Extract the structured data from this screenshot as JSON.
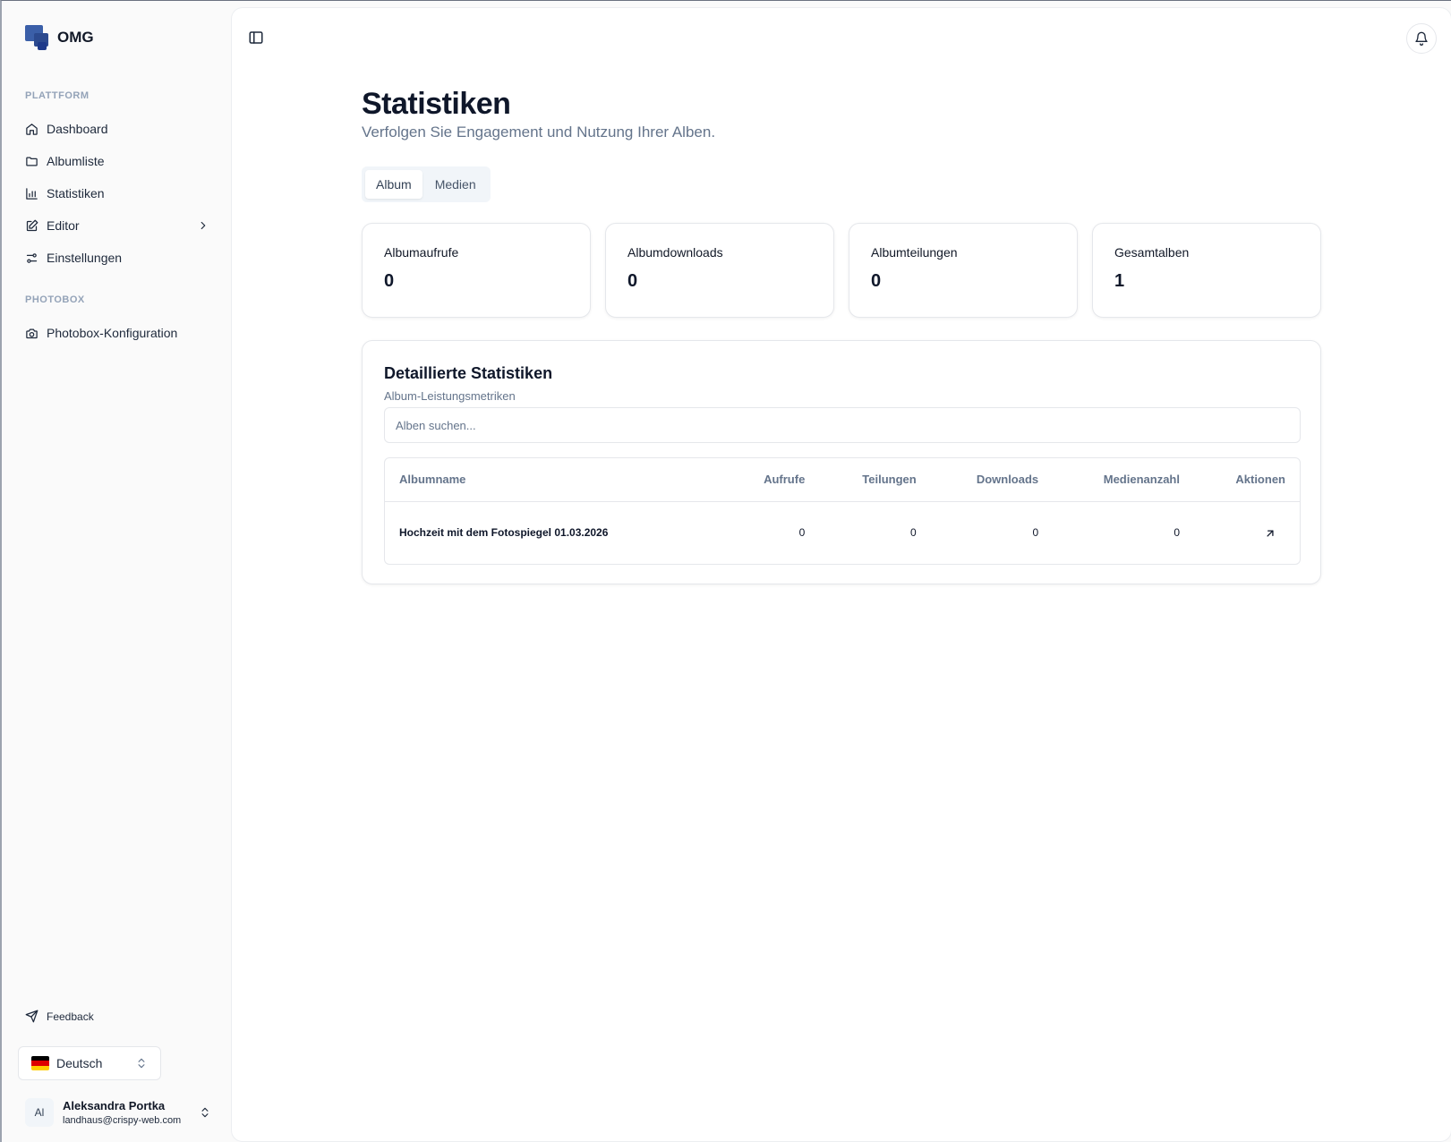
{
  "brand": {
    "name": "OMG"
  },
  "sidebar": {
    "sections": [
      {
        "label": "PLATTFORM"
      },
      {
        "label": "PHOTOBOX"
      }
    ],
    "items": [
      {
        "label": "Dashboard",
        "icon": "home-icon"
      },
      {
        "label": "Albumliste",
        "icon": "folder-icon"
      },
      {
        "label": "Statistiken",
        "icon": "bar-chart-icon"
      },
      {
        "label": "Editor",
        "icon": "edit-icon"
      },
      {
        "label": "Einstellungen",
        "icon": "sliders-icon"
      },
      {
        "label": "Photobox-Konfiguration",
        "icon": "camera-icon"
      }
    ],
    "feedback_label": "Feedback",
    "language": {
      "label": "Deutsch",
      "flag": "de-flag"
    },
    "user": {
      "initials": "Al",
      "name": "Aleksandra Portka",
      "email": "landhaus@crispy-web.com"
    }
  },
  "page": {
    "title": "Statistiken",
    "subtitle": "Verfolgen Sie Engagement und Nutzung Ihrer Alben.",
    "tabs": [
      {
        "label": "Album",
        "active": true
      },
      {
        "label": "Medien",
        "active": false
      }
    ]
  },
  "stats": [
    {
      "label": "Albumaufrufe",
      "value": "0"
    },
    {
      "label": "Albumdownloads",
      "value": "0"
    },
    {
      "label": "Albumteilungen",
      "value": "0"
    },
    {
      "label": "Gesamtalben",
      "value": "1"
    }
  ],
  "details": {
    "title": "Detaillierte Statistiken",
    "subtitle": "Album-Leistungsmetriken",
    "search_placeholder": "Alben suchen...",
    "columns": [
      "Albumname",
      "Aufrufe",
      "Teilungen",
      "Downloads",
      "Medienanzahl",
      "Aktionen"
    ],
    "rows": [
      {
        "name": "Hochzeit mit dem Fotospiegel 01.03.2026",
        "views": "0",
        "shares": "0",
        "downloads": "0",
        "media_count": "0",
        "action_icon": "arrow-up-right-icon"
      }
    ]
  },
  "colors": {
    "brand": "#2c4a8f",
    "sidebar_bg": "#fafafa",
    "text_muted": "#64748b"
  }
}
